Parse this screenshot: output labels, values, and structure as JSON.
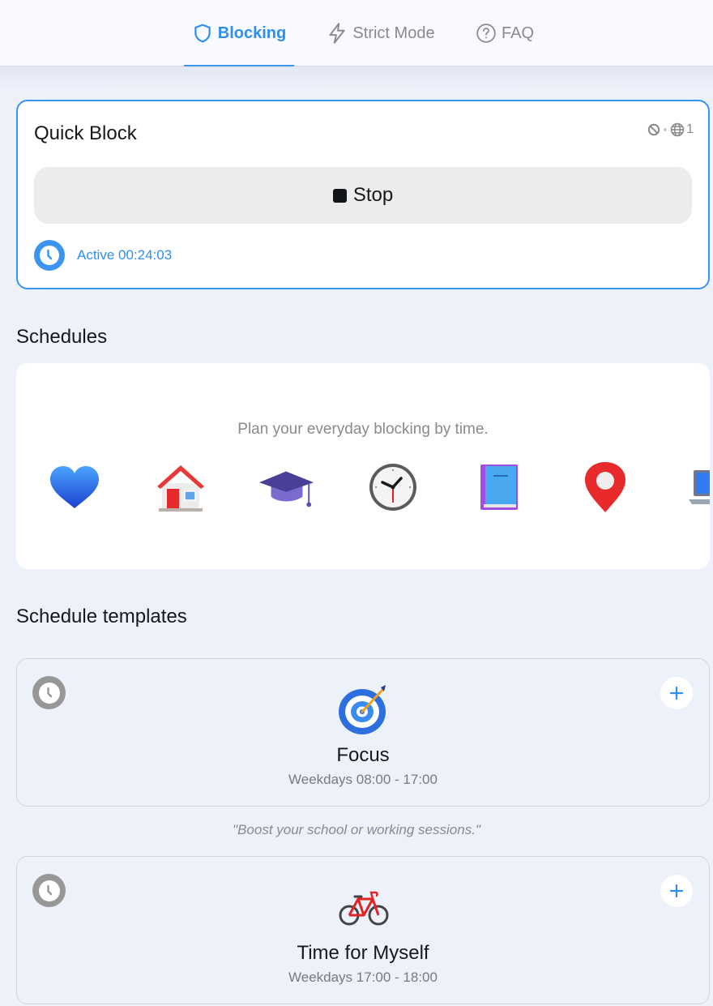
{
  "nav": {
    "tabs": [
      {
        "label": "Blocking",
        "icon": "shield-icon",
        "active": true
      },
      {
        "label": "Strict Mode",
        "icon": "lightning-icon",
        "active": false
      },
      {
        "label": "FAQ",
        "icon": "question-circle-icon",
        "active": false
      }
    ]
  },
  "quick_block": {
    "title": "Quick Block",
    "blocked_sites_count": "1",
    "stop_label": "Stop",
    "status": "Active 00:24:03"
  },
  "schedules": {
    "title": "Schedules",
    "hint": "Plan your everyday blocking by time.",
    "emojis": [
      "blue-heart",
      "house",
      "graduation-cap",
      "clock",
      "book",
      "location-pin",
      "laptop"
    ]
  },
  "templates": {
    "title": "Schedule templates",
    "items": [
      {
        "name": "Focus",
        "time": "Weekdays 08:00 - 17:00",
        "emoji": "target",
        "quote": "\"Boost your school or working sessions.\""
      },
      {
        "name": "Time for Myself",
        "time": "Weekdays 17:00 - 18:00",
        "emoji": "bicycle"
      }
    ]
  },
  "colors": {
    "accent": "#3a94f0",
    "background": "#edf1fa",
    "muted": "#8a8a8a"
  }
}
